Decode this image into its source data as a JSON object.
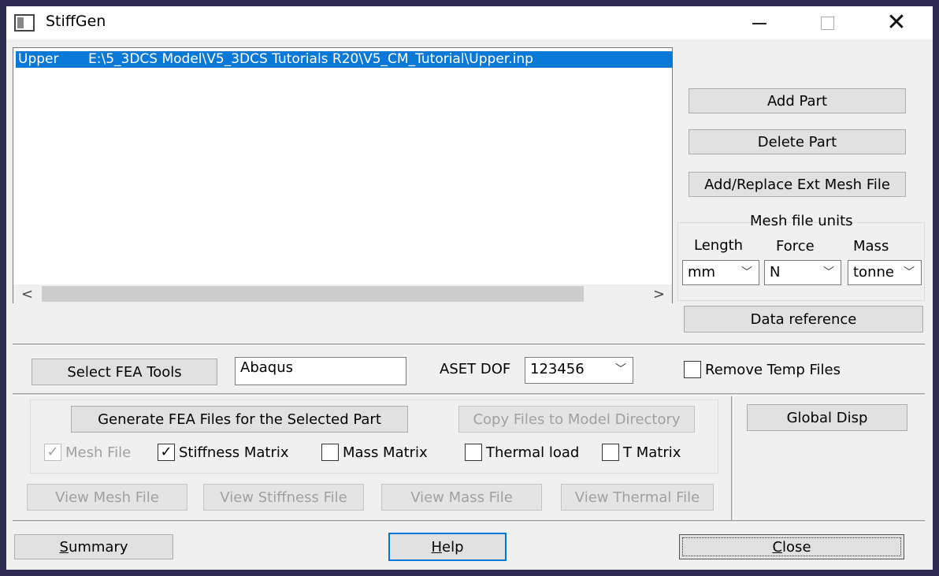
{
  "window": {
    "title": "StiffGen",
    "minimize": "–",
    "close": "✕"
  },
  "parts_list": {
    "rows": [
      {
        "name": "Upper",
        "path": "E:\\5_3DCS Model\\V5_3DCS Tutorials R20\\V5_CM_Tutorial\\Upper.inp"
      }
    ],
    "scroll_left": "<",
    "scroll_right": ">"
  },
  "buttons": {
    "add_part": "Add Part",
    "delete_part": "Delete Part",
    "add_replace_mesh": "Add/Replace Ext Mesh File",
    "data_reference": "Data reference",
    "select_fea_tools": "Select FEA Tools",
    "generate_fea": "Generate FEA Files for the Selected Part",
    "copy_files": "Copy Files to Model Directory",
    "global_disp": "Global Disp",
    "view_mesh": "View Mesh File",
    "view_stiffness": "View Stiffness File",
    "view_mass": "View Mass File",
    "view_thermal": "View Thermal File",
    "summary_u": "S",
    "summary_rest": "ummary",
    "help_u": "H",
    "help_rest": "elp",
    "close_u": "C",
    "close_rest": "lose"
  },
  "mesh_units": {
    "title": "Mesh file units",
    "length_label": "Length",
    "force_label": "Force",
    "mass_label": "Mass",
    "length_value": "mm",
    "force_value": "N",
    "mass_value": "tonne"
  },
  "fea": {
    "tool_value": "Abaqus",
    "aset_label": "ASET DOF",
    "aset_value": "123456",
    "remove_temp_label": "Remove Temp Files"
  },
  "checkboxes": {
    "mesh_file": {
      "label": "Mesh File",
      "checked": true,
      "disabled": true
    },
    "stiffness_matrix": {
      "label": "Stiffness Matrix",
      "checked": true
    },
    "mass_matrix": {
      "label": "Mass Matrix",
      "checked": false
    },
    "thermal_load": {
      "label": "Thermal load",
      "checked": false
    },
    "t_matrix": {
      "label": "T Matrix",
      "checked": false
    }
  },
  "glyphs": {
    "check": "✓",
    "chevron": "﹀"
  }
}
